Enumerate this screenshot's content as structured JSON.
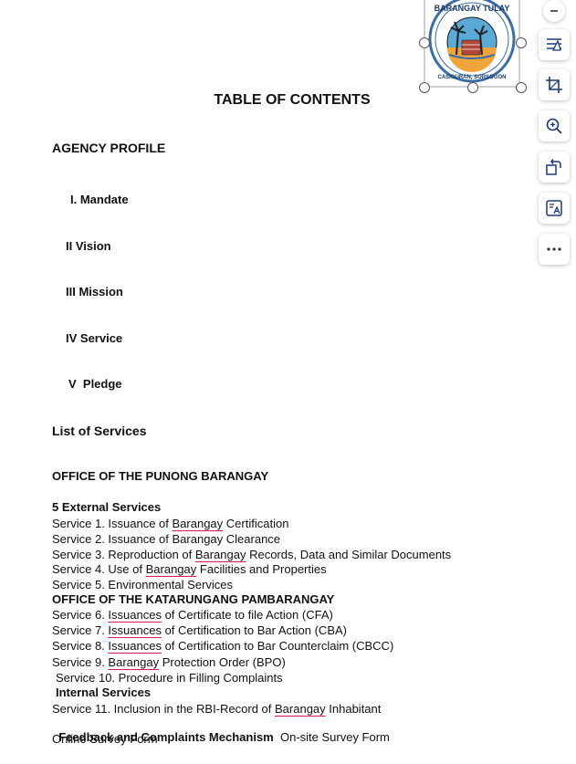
{
  "logo": {
    "top_text": "BARANGAY TULAY",
    "bottom_text": "CASIGURAN, SORSOGON",
    "colors": {
      "ring": "#3a6ea5",
      "sky": "#5aa9d6",
      "sun": "#f0a53a",
      "ground": "#b0483a",
      "tree": "#222222"
    }
  },
  "toolbar": {
    "items": [
      "minus-icon",
      "layout-icon",
      "crop-icon",
      "zoom-in-icon",
      "rotate-icon",
      "translate-icon",
      "more-icon"
    ],
    "accent": "#1a3a7a"
  },
  "doc": {
    "title": "TABLE OF CONTENTS",
    "agency_profile": "AGENCY PROFILE",
    "items": [
      "I. Mandate",
      "II Vision",
      "III Mission",
      "IV Service",
      "V  Pledge"
    ],
    "list_of_services": "List of Services",
    "office_punong": "OFFICE OF THE PUNONG BARANGAY",
    "external_header": "5 External Services",
    "s1": {
      "a": "Service 1. Issuance of ",
      "b": "Barangay",
      "c": " Certification"
    },
    "s2": "Service 2. Issuance of Barangay Clearance",
    "s3": {
      "a": "Service 3. Reproduction of ",
      "b": "Barangay",
      "c": " Records, Data and Similar Documents"
    },
    "s4": {
      "a": "Service 4. Use of ",
      "b": "Barangay",
      "c": " Facilities and Properties"
    },
    "s5": "Service 5. Environmental Services",
    "office_katarungang": "OFFICE OF THE KATARUNGANG PAMBARANGAY",
    "s6": {
      "a": "Service 6. ",
      "b": "Issuances",
      "c": " of Certificate to file Action (CFA)"
    },
    "s7": {
      "a": "Service 7. ",
      "b": "Issuances",
      "c": " of Certification to Bar Action (CBA)"
    },
    "s8": {
      "a": "Service 8. ",
      "b": "Issuances",
      "c": " of Certification to Bar Counterclaim (CBCC)"
    },
    "s9": {
      "a": "Service 9. ",
      "b": "Barangay",
      "c": " Protection Order (BPO)"
    },
    "s10": "Service 10. Procedure in Filling Complaints",
    "internal_header": "Internal Services",
    "s11": {
      "a": "Service 11. Inclusion in the RBI-Record of ",
      "b": "Barangay",
      "c": " Inhabitant"
    },
    "feedback": {
      "a": "Feedback and Complaints Mechanism",
      "b": "  On-site Survey Form"
    },
    "online": "Online Survey Form"
  }
}
